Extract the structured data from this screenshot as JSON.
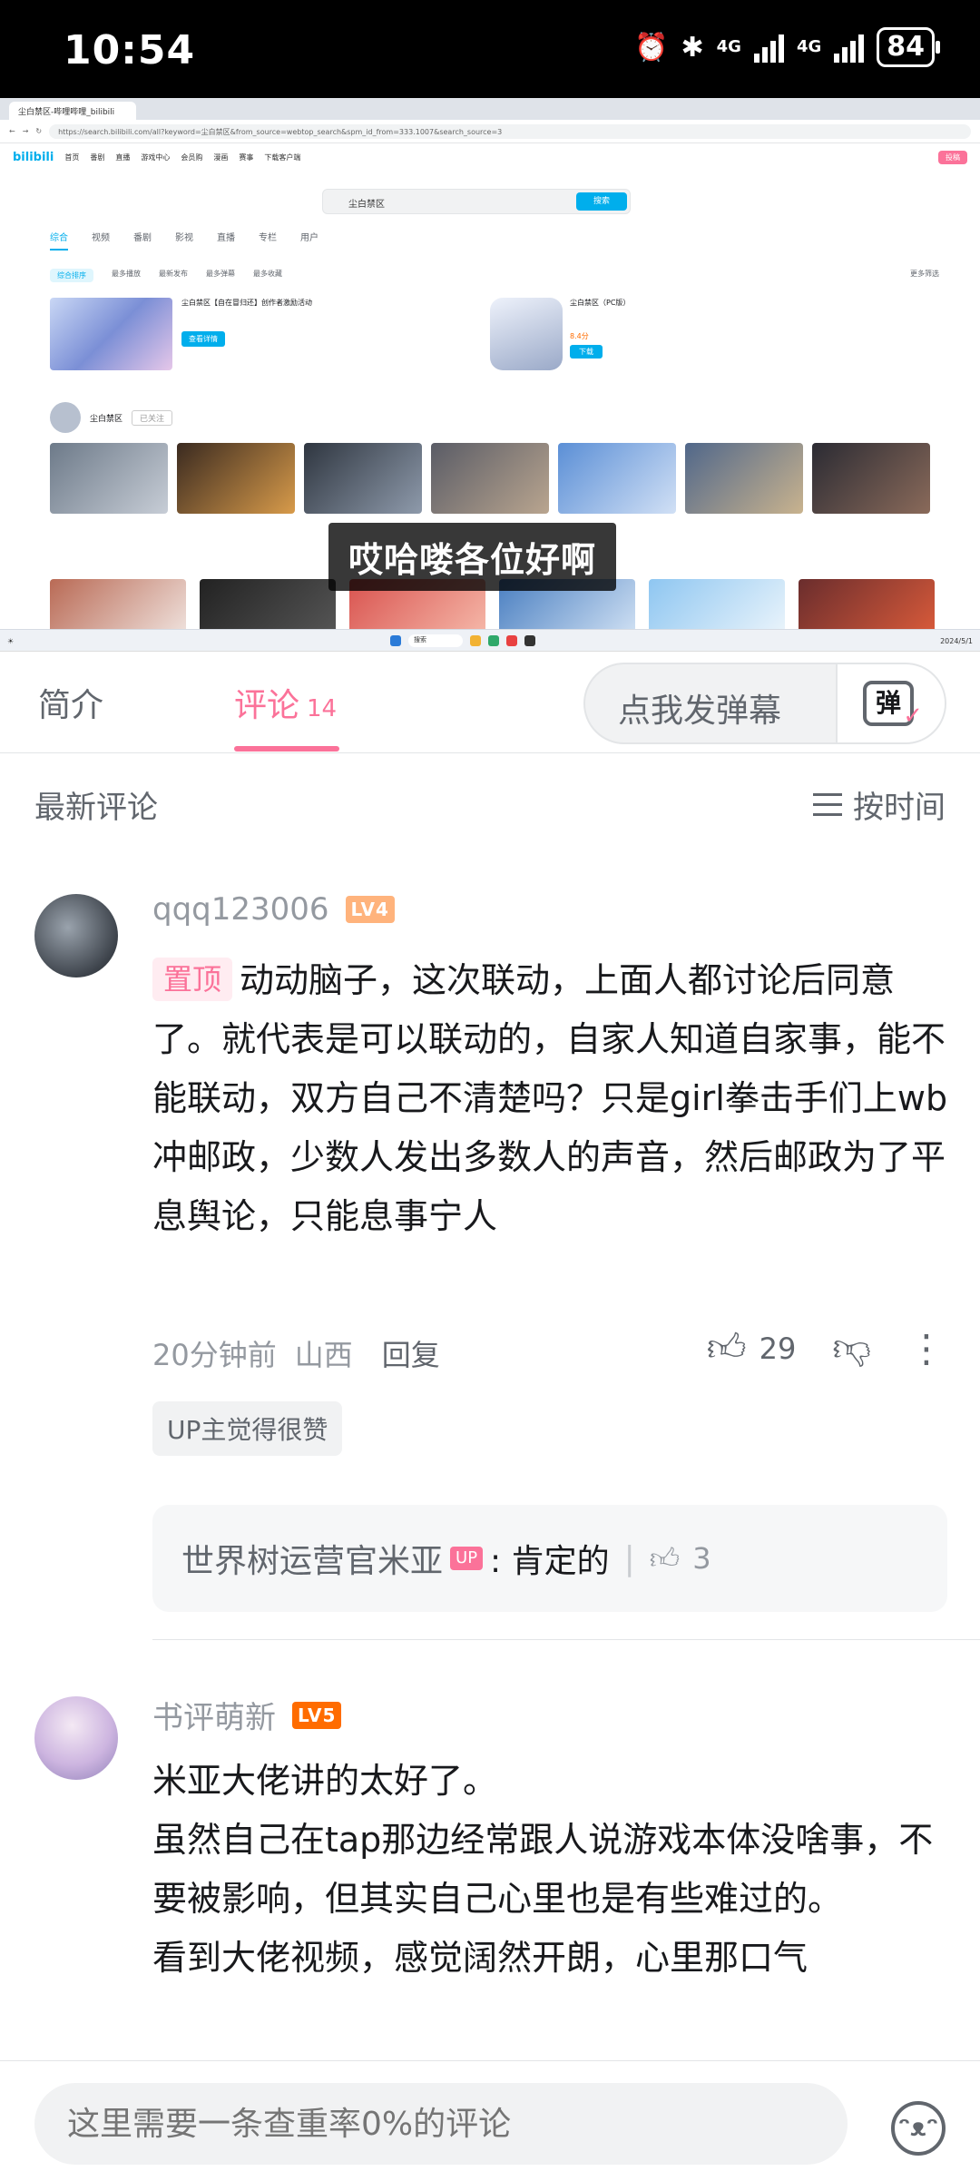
{
  "status_bar": {
    "time": "10:54",
    "battery": "84",
    "net1": "4G",
    "net2": "4G"
  },
  "video": {
    "browser_tab": "尘白禁区-哔哩哔哩_bilibili",
    "url": "https://search.bilibili.com/all?keyword=尘白禁区&from_source=webtop_search&spm_id_from=333.1007&search_source=3",
    "site_logo": "bilibili",
    "search_text": "尘白禁区",
    "search_button": "搜索",
    "top_nav": [
      "首页",
      "番剧",
      "直播",
      "游戏中心",
      "会员购",
      "漫画",
      "赛事",
      "下载客户端"
    ],
    "top_right_button": "投稿",
    "result_tabs": [
      "综合",
      "视频",
      "番剧",
      "影视",
      "直播",
      "专栏",
      "用户"
    ],
    "filters": [
      "综合排序",
      "最多播放",
      "最新发布",
      "最多弹幕",
      "最多收藏"
    ],
    "more_filter": "更多筛选",
    "card1_title": "尘白禁区【自在冒归还】创作者激励活动",
    "card1_button": "查看详情",
    "card2_title": "尘白禁区（PC版）",
    "card2_rating": "8.4分",
    "card2_download": "下载",
    "up_name": "尘白禁区",
    "up_followed": "已关注",
    "caption": "哎哈喽各位好啊",
    "taskbar_search": "搜索",
    "taskbar_date": "2024/5/1"
  },
  "tabs": {
    "intro": "简介",
    "comments": "评论",
    "comment_count": "14",
    "danmaku_placeholder": "点我发弹幕",
    "danmaku_icon_char": "弹"
  },
  "sort": {
    "label": "最新评论",
    "order": "按时间"
  },
  "comments": [
    {
      "user": "qqq123006",
      "level": "LV4",
      "level_color": "#ffb37c",
      "pin": "置顶",
      "text": "动动脑子，这次联动，上面人都讨论后同意了。就代表是可以联动的，自家人知道自家事，能不能联动，双方自己不清楚吗？只是girl拳击手们上wb冲邮政，少数人发出多数人的声音，然后邮政为了平息舆论，只能息事宁人",
      "time": "20分钟前",
      "location": "山西",
      "reply_label": "回复",
      "likes": "29",
      "up_liked": "UP主觉得很赞",
      "sub_reply": {
        "name": "世界树运营官米亚",
        "tag": "UP",
        "text": ": 肯定的",
        "likes": "3"
      }
    },
    {
      "user": "书评萌新",
      "level": "LV5",
      "level_color": "#ff6c00",
      "lines": [
        "米亚大佬讲的太好了。",
        "虽然自己在tap那边经常跟人说游戏本体没啥事，不要被影响，但其实自己心里也是有些难过的。",
        "看到大佬视频，感觉阔然开朗，心里那口气"
      ]
    }
  ],
  "input": {
    "placeholder": "这里需要一条查重率0%的评论"
  },
  "colors": {
    "accent": "#fb7299",
    "bili_blue": "#00aeec"
  }
}
